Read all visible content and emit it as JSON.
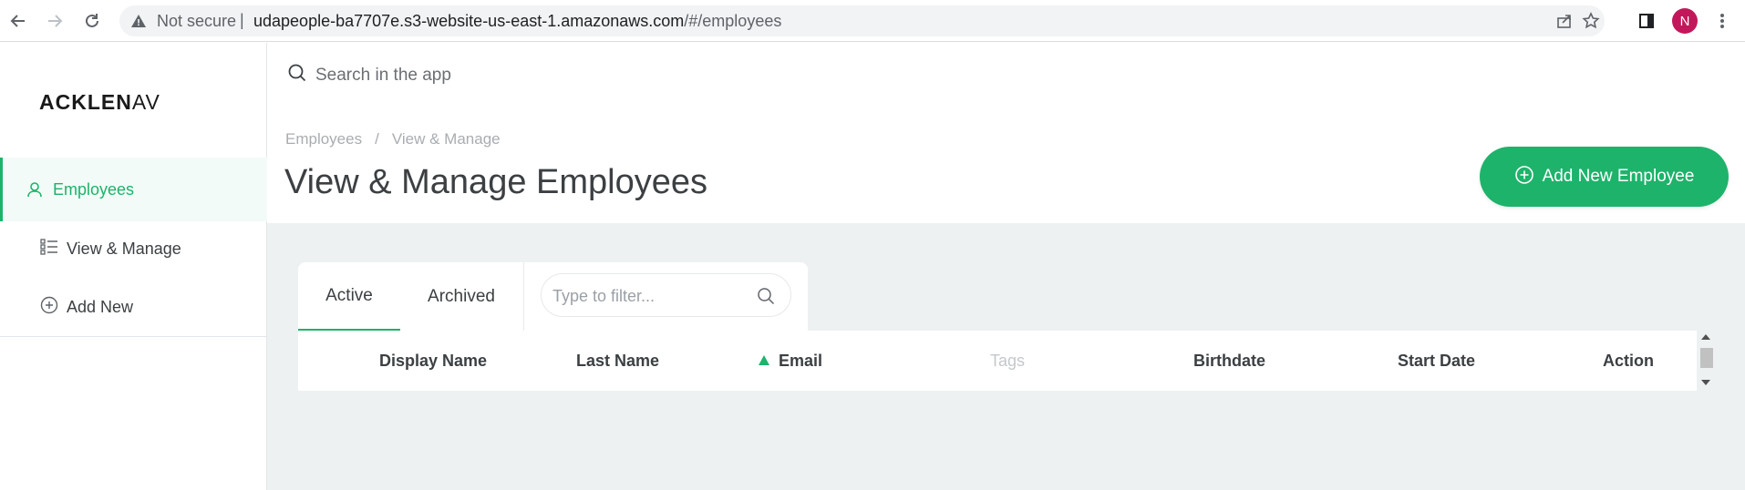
{
  "browser": {
    "security_label": "Not secure",
    "separator": "|",
    "url_host": "udapeople-ba7707e.s3-website-us-east-1.amazonaws.com",
    "url_path": "/#/employees",
    "profile_initial": "N"
  },
  "sidebar": {
    "logo_bold": "ACKLEN",
    "logo_thin": "AV",
    "items": [
      {
        "label": "Employees",
        "icon": "user-icon",
        "active": true
      },
      {
        "label": "View & Manage",
        "icon": "list-icon"
      },
      {
        "label": "Add New",
        "icon": "plus-circle-icon"
      }
    ]
  },
  "header": {
    "search_placeholder": "Search in the app",
    "breadcrumb": [
      "Employees",
      "View & Manage"
    ],
    "breadcrumb_separator": "/",
    "title": "View & Manage Employees",
    "add_button_label": "Add New Employee"
  },
  "tabs": [
    {
      "label": "Active",
      "active": true
    },
    {
      "label": "Archived"
    }
  ],
  "filter": {
    "placeholder": "Type to filter..."
  },
  "table": {
    "columns": [
      "Display Name",
      "Last Name",
      "Email",
      "Tags",
      "Birthdate",
      "Start Date",
      "Action"
    ],
    "sorted_column": "Email",
    "sort_direction": "ascending"
  },
  "colors": {
    "accent": "#1db36b",
    "content_bg": "#eef1f2",
    "profile": "#c2185b"
  }
}
